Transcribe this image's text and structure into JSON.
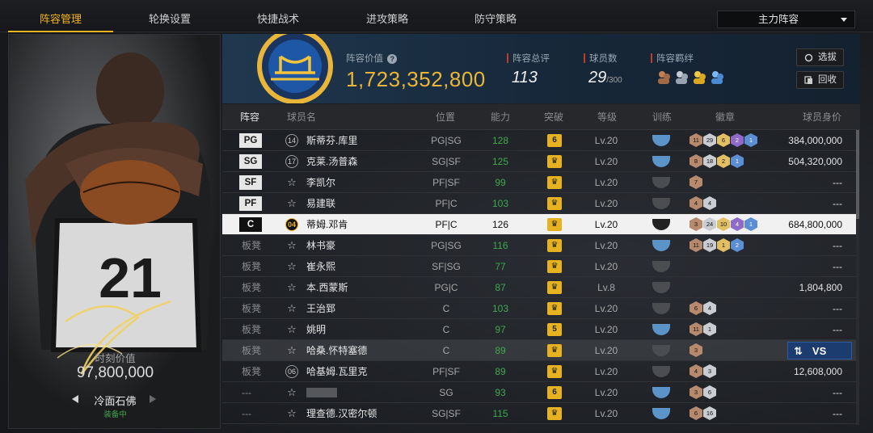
{
  "nav": {
    "tabs": [
      "阵容管理",
      "轮换设置",
      "快捷战术",
      "进攻策略",
      "防守策略"
    ],
    "active_tab": "阵容管理",
    "lineup_select": "主力阵容"
  },
  "card": {
    "jersey": "21",
    "value_label": "时刻价值",
    "value": "97,800,000",
    "name": "冷面石佛",
    "status": "装备中"
  },
  "team": {
    "value_label": "阵容价值",
    "value": "1,723,352,800",
    "rating_label": "阵容总评",
    "rating": "113",
    "count_label": "球员数",
    "count": "29",
    "count_max": "/300",
    "bond_label": "阵容羁绊",
    "select_button": "选拔",
    "recycle_button": "回收"
  },
  "table": {
    "headers": [
      "阵容",
      "球员名",
      "位置",
      "能力",
      "突破",
      "等级",
      "训练",
      "徽章",
      "球员身价"
    ],
    "rows": [
      {
        "slot": "PG",
        "num": "14",
        "name": "斯蒂芬.库里",
        "pos": "PG|SG",
        "ability": "128",
        "break": "6",
        "level": "Lv.20",
        "train": "blue",
        "badges": [
          [
            "11",
            "br"
          ],
          [
            "29",
            "si"
          ],
          [
            "6",
            "go"
          ],
          [
            "2",
            "pu"
          ],
          [
            "1",
            "bl"
          ]
        ],
        "price": "384,000,000"
      },
      {
        "slot": "SG",
        "num": "17",
        "name": "克莱.汤普森",
        "pos": "SG|SF",
        "ability": "125",
        "break": "",
        "level": "Lv.20",
        "train": "blue",
        "badges": [
          [
            "8",
            "br"
          ],
          [
            "18",
            "si"
          ],
          [
            "2",
            "go"
          ],
          [
            "1",
            "bl"
          ]
        ],
        "price": "504,320,000"
      },
      {
        "slot": "SF",
        "num": "",
        "name": "李凯尔",
        "pos": "PF|SF",
        "ability": "99",
        "break": "",
        "level": "Lv.20",
        "train": "gray",
        "badges": [
          [
            "7",
            "br"
          ]
        ],
        "price": "---"
      },
      {
        "slot": "PF",
        "num": "",
        "name": "易建联",
        "pos": "PF|C",
        "ability": "103",
        "break": "",
        "level": "Lv.20",
        "train": "gray",
        "badges": [
          [
            "4",
            "br"
          ],
          [
            "4",
            "si"
          ]
        ],
        "price": "---"
      },
      {
        "slot": "C",
        "num": "04",
        "name": "蒂姆.邓肯",
        "pos": "PF|C",
        "ability": "126",
        "break": "",
        "level": "Lv.20",
        "train": "black",
        "badges": [
          [
            "3",
            "br"
          ],
          [
            "24",
            "si"
          ],
          [
            "10",
            "go"
          ],
          [
            "4",
            "pu"
          ],
          [
            "1",
            "bl"
          ]
        ],
        "price": "684,800,000"
      },
      {
        "slot": "板凳",
        "num": "",
        "name": "林书豪",
        "pos": "PG|SG",
        "ability": "116",
        "break": "",
        "level": "Lv.20",
        "train": "blue",
        "badges": [
          [
            "11",
            "br"
          ],
          [
            "19",
            "si"
          ],
          [
            "1",
            "go"
          ],
          [
            "2",
            "bl"
          ]
        ],
        "price": "---"
      },
      {
        "slot": "板凳",
        "num": "",
        "name": "崔永熙",
        "pos": "SF|SG",
        "ability": "77",
        "break": "",
        "level": "Lv.20",
        "train": "gray",
        "badges": [],
        "price": "---"
      },
      {
        "slot": "板凳",
        "num": "",
        "name": "本.西蒙斯",
        "pos": "PG|C",
        "ability": "87",
        "break": "",
        "level": "Lv.8",
        "train": "gray",
        "badges": [],
        "price": "1,804,800"
      },
      {
        "slot": "板凳",
        "num": "",
        "name": "王治郅",
        "pos": "C",
        "ability": "103",
        "break": "",
        "level": "Lv.20",
        "train": "gray",
        "badges": [
          [
            "6",
            "br"
          ],
          [
            "4",
            "si"
          ]
        ],
        "price": "---"
      },
      {
        "slot": "板凳",
        "num": "",
        "name": "姚明",
        "pos": "C",
        "ability": "97",
        "break": "5",
        "level": "Lv.20",
        "train": "blue2",
        "badges": [
          [
            "11",
            "br"
          ],
          [
            "1",
            "si"
          ]
        ],
        "price": "---"
      },
      {
        "slot": "板凳",
        "num": "",
        "name": "哈桑.怀特塞德",
        "pos": "C",
        "ability": "89",
        "break": "",
        "level": "Lv.20",
        "train": "gray",
        "badges": [
          [
            "3",
            "br"
          ]
        ],
        "price": ""
      },
      {
        "slot": "板凳",
        "num": "06",
        "name": "哈基姆.瓦里克",
        "pos": "PF|SF",
        "ability": "89",
        "break": "",
        "level": "Lv.20",
        "train": "gray",
        "badges": [
          [
            "4",
            "br"
          ],
          [
            "3",
            "si"
          ]
        ],
        "price": "12,608,000"
      },
      {
        "slot": "---",
        "num": "",
        "name": "",
        "pos": "SG",
        "ability": "93",
        "break": "6",
        "level": "Lv.20",
        "train": "blue2",
        "badges": [
          [
            "3",
            "br"
          ],
          [
            "6",
            "si"
          ]
        ],
        "price": "---"
      },
      {
        "slot": "---",
        "num": "",
        "name": "理查德.汉密尔顿",
        "pos": "SG|SF",
        "ability": "115",
        "break": "",
        "level": "Lv.20",
        "train": "blue",
        "badges": [
          [
            "6",
            "br"
          ],
          [
            "16",
            "si"
          ]
        ],
        "price": "---"
      }
    ]
  },
  "vs_button": "VS",
  "colors": {
    "accent": "#f3b321",
    "green": "#40a84e",
    "selected_row": "#f1f1f1"
  }
}
